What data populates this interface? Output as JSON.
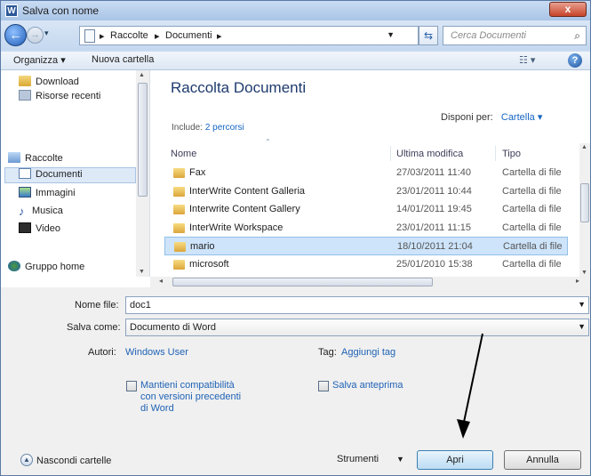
{
  "title": "Salva con nome",
  "close_glyph": "x",
  "nav": {
    "breadcrumb": [
      "Raccolte",
      "Documenti"
    ],
    "search_placeholder": "Cerca Documenti"
  },
  "toolbar": {
    "organize": "Organizza ▾",
    "new_folder": "Nuova cartella"
  },
  "sidebar": {
    "items": [
      "Download",
      "Risorse recenti",
      "Raccolte",
      "Documenti",
      "Immagini",
      "Musica",
      "Video",
      "Gruppo home"
    ],
    "selected": "Documenti"
  },
  "library": {
    "title": "Raccolta Documenti",
    "include_label": "Include:",
    "include_link": "2 percorsi",
    "arrange_label": "Disponi per:",
    "arrange_value": "Cartella ▾"
  },
  "columns": [
    "Nome",
    "Ultima modifica",
    "Tipo"
  ],
  "files": [
    {
      "name": "Fax",
      "date": "27/03/2011 11:40",
      "type": "Cartella di file"
    },
    {
      "name": "InterWrite Content Galleria",
      "date": "23/01/2011 10:44",
      "type": "Cartella di file"
    },
    {
      "name": "Interwrite Content Gallery",
      "date": "14/01/2011 19:45",
      "type": "Cartella di file"
    },
    {
      "name": "InterWrite Workspace",
      "date": "23/01/2011 11:15",
      "type": "Cartella di file"
    },
    {
      "name": "mario",
      "date": "18/10/2011 21:04",
      "type": "Cartella di file"
    },
    {
      "name": "microsoft",
      "date": "25/01/2010 15:38",
      "type": "Cartella di file"
    }
  ],
  "selected_file": "mario",
  "form": {
    "filename_label": "Nome file:",
    "filename_value": "doc1",
    "savetype_label": "Salva come:",
    "savetype_value": "Documento di Word",
    "authors_label": "Autori:",
    "authors_value": "Windows User",
    "tags_label": "Tag:",
    "tags_value": "Aggiungi tag",
    "compat_label": "Mantieni compatibilità con versioni precedenti di Word",
    "thumb_label": "Salva anteprima"
  },
  "footer": {
    "hide_folders": "Nascondi cartelle",
    "tools": "Strumenti",
    "open": "Apri",
    "cancel": "Annulla"
  },
  "colors": {
    "accent": "#1f62b5",
    "selection": "#cde4fb"
  }
}
